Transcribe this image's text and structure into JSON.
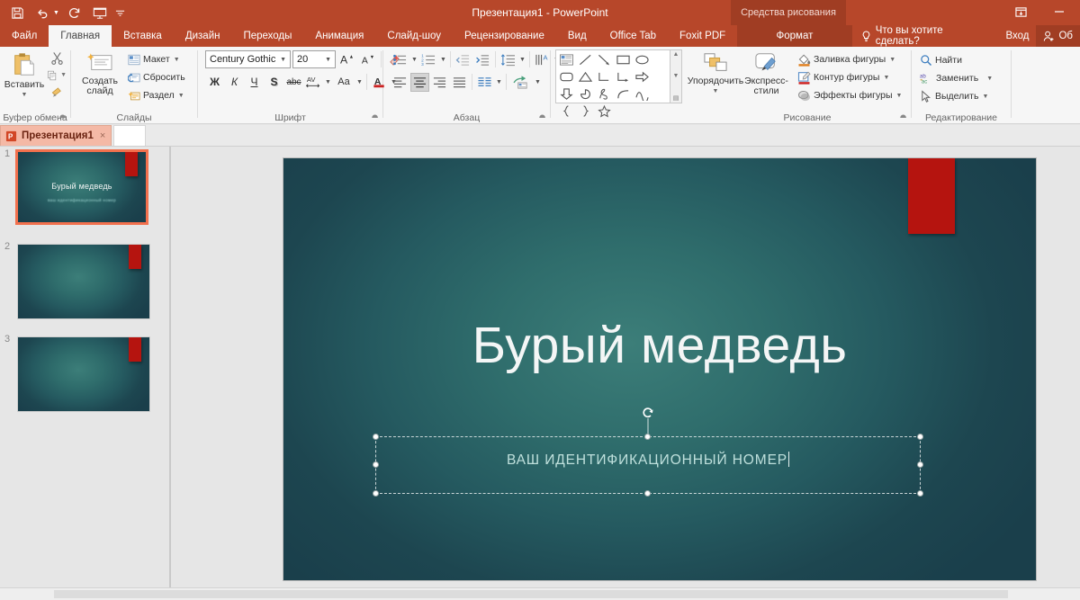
{
  "titlebar": {
    "document_title": "Презентация1 - PowerPoint",
    "contextual_tab_group": "Средства рисования",
    "quick_access": [
      {
        "name": "save",
        "label": "Сохранить"
      },
      {
        "name": "undo",
        "label": "Отменить"
      },
      {
        "name": "redo",
        "label": "Повторить"
      },
      {
        "name": "start-slideshow",
        "label": "Начать показ слайдов"
      },
      {
        "name": "customize-qat",
        "label": "Настройка панели быстрого доступа"
      }
    ],
    "window_controls": {
      "ribbon_display": "Параметры отображения ленты",
      "minimize": "—"
    }
  },
  "tabs": [
    {
      "label": "Файл",
      "active": false
    },
    {
      "label": "Главная",
      "active": true
    },
    {
      "label": "Вставка",
      "active": false
    },
    {
      "label": "Дизайн",
      "active": false
    },
    {
      "label": "Переходы",
      "active": false
    },
    {
      "label": "Анимация",
      "active": false
    },
    {
      "label": "Слайд-шоу",
      "active": false
    },
    {
      "label": "Рецензирование",
      "active": false
    },
    {
      "label": "Вид",
      "active": false
    },
    {
      "label": "Office Tab",
      "active": false
    },
    {
      "label": "Foxit PDF",
      "active": false
    },
    {
      "label": "Формат",
      "active": false,
      "contextual": true
    }
  ],
  "tellme": {
    "placeholder": "Что вы хотите сделать?"
  },
  "signin": {
    "label": "Вход",
    "account": "Об"
  },
  "ribbon": {
    "clipboard": {
      "title": "Буфер обмена",
      "paste": "Вставить",
      "cut": "Вырезать",
      "copy": "Копировать",
      "format_painter": "Формат по образцу"
    },
    "slides": {
      "title": "Слайды",
      "new_slide_line1": "Создать",
      "new_slide_line2": "слайд",
      "layout": "Макет",
      "reset": "Сбросить",
      "section": "Раздел"
    },
    "font": {
      "title": "Шрифт",
      "font_name": "Century Gothic",
      "font_size": "20",
      "grow": "A",
      "shrink": "A",
      "clear_formatting": "Очистить формат",
      "bold": "Ж",
      "italic": "К",
      "underline": "Ч",
      "shadow": "S",
      "strikethrough": "abc",
      "spacing": "AV",
      "change_case": "Aa",
      "font_color": "A"
    },
    "paragraph": {
      "title": "Абзац",
      "bullets": "Маркеры",
      "numbering": "Нумерация",
      "decrease_indent": "Уменьшить отступ",
      "increase_indent": "Увеличить отступ",
      "line_spacing": "Междустрочный интервал",
      "text_direction": "Направление текста",
      "align_text": "Выровнять текст",
      "convert_smartart": "Преобразовать в SmartArt",
      "align_left": "По левому краю",
      "align_center": "По центру",
      "align_right": "По правому краю",
      "justify": "По ширине",
      "columns": "Колонки"
    },
    "drawing": {
      "title": "Рисование",
      "arrange": "Упорядочить",
      "quick_styles_line1": "Экспресс-",
      "quick_styles_line2": "стили",
      "shape_fill": "Заливка фигуры",
      "shape_outline": "Контур фигуры",
      "shape_effects": "Эффекты фигуры"
    },
    "editing": {
      "title": "Редактирование",
      "find": "Найти",
      "replace": "Заменить",
      "select": "Выделить"
    }
  },
  "office_tab": {
    "document_name": "Презентация1",
    "close_label": "×"
  },
  "slide_panel": {
    "slides": [
      {
        "number": "1",
        "title": "Бурый медведь",
        "subtitle": "ваш идентификационный номер",
        "selected": true
      },
      {
        "number": "2",
        "title": "",
        "subtitle": "",
        "selected": false
      },
      {
        "number": "3",
        "title": "",
        "subtitle": "",
        "selected": false
      }
    ]
  },
  "slide": {
    "title": "Бурый медведь",
    "subtitle": "ВАШ ИДЕНТИФИКАЦИОННЫЙ НОМЕР",
    "selected_placeholder": "subtitle",
    "colors": {
      "background_center": "#3c7e79",
      "background_edge": "#1a3f4b",
      "accent_rectangle": "#b5140f",
      "title_text": "#f4f6f6",
      "subtitle_text": "#bfe0dc"
    }
  },
  "theme_colors": {
    "titlebar": "#b7472a",
    "contextual": "#a03d23",
    "ribbon_bg": "#f6f6f6",
    "workspace": "#e6e6e6",
    "doctab": "#f4b9a6"
  }
}
